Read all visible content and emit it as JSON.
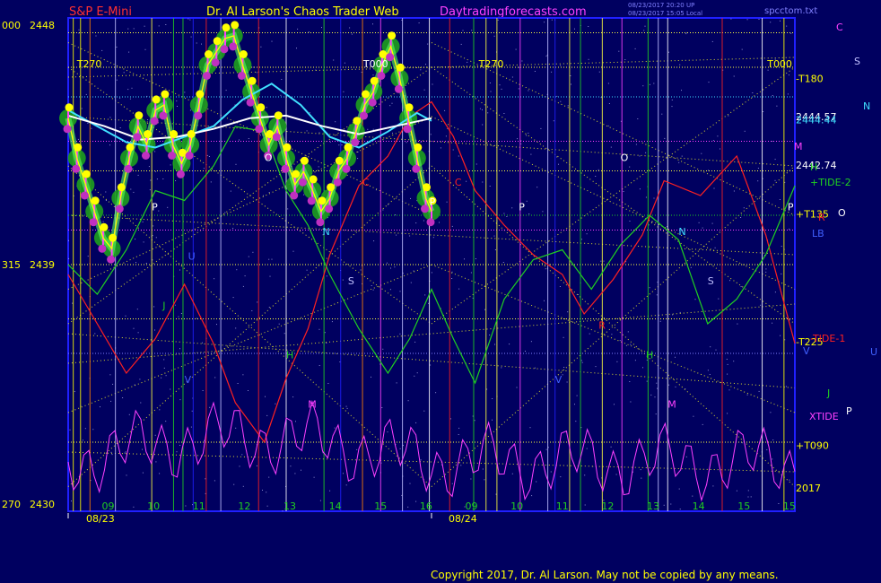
{
  "header": {
    "symbol": "S&P E-Mini",
    "site_title": "Dr. Al Larson's Chaos Trader Web",
    "site_url": "Daytradingforecasts.com",
    "stamp_line1": "08/23/2017 20:20 UP",
    "stamp_line2": "08/23/2017 15:05 Local",
    "filename": "spcctom.txt"
  },
  "copyright": "Copyright 2017, Dr. Al Larson. May not be copied by any means.",
  "colors": {
    "background": "#000060",
    "plot_border": "#2020ff",
    "price_bars": "#ff40ff",
    "cyan_avg": "#40e0ff",
    "white_avg": "#ffffff",
    "yellow_trace": "#ffff00",
    "green_glow": "#1e9e1e",
    "magenta_osc": "#ff40ff",
    "red_tide": "#ff2020",
    "green_tide": "#20d020"
  },
  "chart_data": {
    "type": "line",
    "title": "S&P E-Mini",
    "yaxis": {
      "min": 2430,
      "max": 2448
    },
    "y_ticks": [
      {
        "left": "000",
        "value_label": "2448",
        "value": 2448
      },
      {
        "left": "315",
        "value_label": "2439",
        "value": 2439
      },
      {
        "left": "270",
        "value_label": "2430",
        "value": 2430
      }
    ],
    "dates": [
      "08/23",
      "08/24"
    ],
    "day_hours": [
      "09",
      "10",
      "11",
      "12",
      "13",
      "14",
      "15",
      "16"
    ],
    "next_day_hours": [
      "09",
      "10",
      "11",
      "12",
      "13",
      "14",
      "15",
      "15"
    ],
    "right_price_labels": [
      {
        "text": "2444.57",
        "value": 2444.57
      },
      {
        "text": "2444.44",
        "value": 2444.44
      },
      {
        "text": "2442.74",
        "value": 2442.74
      }
    ],
    "right_field_labels": [
      {
        "text": "-T180",
        "value": 2446.0
      },
      {
        "text": "+T135",
        "value": 2440.9
      },
      {
        "text": "-T225",
        "value": 2436.1
      },
      {
        "text": "+T090",
        "value": 2432.2
      },
      {
        "text": "2017",
        "value": 2430.6
      }
    ],
    "right_legend": [
      {
        "text": "C",
        "color": "#ff40ff"
      },
      {
        "text": "S",
        "color": "#c0c0ff"
      },
      {
        "text": "N",
        "color": "#40e0ff"
      },
      {
        "text": "M",
        "color": "#ff40ff"
      },
      {
        "text": "H",
        "color": "#20d020"
      },
      {
        "text": "+TIDE-2",
        "color": "#20d020"
      },
      {
        "text": "R",
        "color": "#ff2020"
      },
      {
        "text": "O",
        "color": "#ffffff"
      },
      {
        "text": "LB",
        "color": "#4060ff"
      },
      {
        "text": "-TIDE-1",
        "color": "#ff2020"
      },
      {
        "text": "V",
        "color": "#4060ff"
      },
      {
        "text": "U",
        "color": "#4060ff"
      },
      {
        "text": "J",
        "color": "#20d020"
      },
      {
        "text": "XTIDE",
        "color": "#ff40ff"
      },
      {
        "text": "P",
        "color": "#ffffff"
      }
    ],
    "cycle_markers": [
      {
        "text": "T270",
        "color": "#ffff00",
        "day": 1
      },
      {
        "text": "T000",
        "color": "#ffffff",
        "day": 1
      },
      {
        "text": "T270",
        "color": "#ffff00",
        "day": 2
      },
      {
        "text": "T000",
        "color": "#ffff00",
        "day": 2
      }
    ],
    "plot_letters": [
      {
        "text": "O",
        "color": "#ffffff"
      },
      {
        "text": "P",
        "color": "#ffffff"
      },
      {
        "text": "C",
        "color": "#ff2020"
      },
      {
        "text": "C",
        "color": "#ff2020"
      },
      {
        "text": "P",
        "color": "#ffffff"
      },
      {
        "text": "P",
        "color": "#ffffff"
      },
      {
        "text": "O",
        "color": "#ffffff"
      },
      {
        "text": "N",
        "color": "#40e0ff"
      },
      {
        "text": "S",
        "color": "#c0c0ff"
      },
      {
        "text": "H",
        "color": "#20d020"
      },
      {
        "text": "M",
        "color": "#ff40ff"
      },
      {
        "text": "N",
        "color": "#40e0ff"
      },
      {
        "text": "S",
        "color": "#c0c0ff"
      },
      {
        "text": "H",
        "color": "#20d020"
      },
      {
        "text": "M",
        "color": "#ff40ff"
      },
      {
        "text": "J",
        "color": "#20d020"
      },
      {
        "text": "U",
        "color": "#4060ff"
      },
      {
        "text": "V",
        "color": "#4060ff"
      },
      {
        "text": "V",
        "color": "#4060ff"
      },
      {
        "text": "R",
        "color": "#ff2020"
      },
      {
        "text": "P",
        "color": "#ffffff"
      }
    ],
    "price_series": {
      "name": "S&P E-Mini",
      "x_frac": [
        0.0,
        0.012,
        0.024,
        0.036,
        0.048,
        0.06,
        0.072,
        0.084,
        0.096,
        0.108,
        0.12,
        0.132,
        0.144,
        0.156,
        0.168,
        0.18,
        0.192,
        0.204,
        0.216,
        0.228,
        0.24,
        0.252,
        0.264,
        0.276,
        0.288,
        0.3,
        0.312,
        0.324,
        0.336,
        0.348,
        0.36,
        0.372,
        0.384,
        0.396,
        0.408,
        0.42,
        0.432,
        0.444,
        0.456,
        0.468,
        0.48,
        0.492,
        0.5
      ],
      "values": [
        2444.5,
        2443.0,
        2442.0,
        2441.0,
        2440.0,
        2439.6,
        2441.5,
        2443.0,
        2444.2,
        2443.5,
        2444.8,
        2445.0,
        2443.5,
        2442.8,
        2443.5,
        2445.0,
        2446.5,
        2447.0,
        2447.5,
        2447.6,
        2446.5,
        2445.5,
        2444.5,
        2443.5,
        2444.2,
        2443.0,
        2442.0,
        2442.5,
        2441.8,
        2441.0,
        2441.5,
        2442.5,
        2443.0,
        2444.0,
        2445.0,
        2445.5,
        2446.5,
        2447.2,
        2446.0,
        2444.5,
        2443.0,
        2441.5,
        2441.0
      ]
    },
    "series": [
      {
        "color": "#40e0ff",
        "x_frac": [
          0.0,
          0.04,
          0.08,
          0.12,
          0.16,
          0.2,
          0.24,
          0.28,
          0.32,
          0.36,
          0.4,
          0.44,
          0.48,
          0.5
        ],
        "values": [
          2444.8,
          2444.2,
          2443.6,
          2443.4,
          2443.8,
          2444.2,
          2445.2,
          2445.8,
          2445.0,
          2443.8,
          2443.4,
          2444.0,
          2444.7,
          2444.4
        ]
      },
      {
        "color": "#ffffff",
        "x_frac": [
          0.0,
          0.05,
          0.1,
          0.15,
          0.2,
          0.25,
          0.3,
          0.35,
          0.4,
          0.45,
          0.5
        ],
        "values": [
          2444.6,
          2444.2,
          2443.7,
          2443.8,
          2444.1,
          2444.5,
          2444.6,
          2444.2,
          2443.9,
          2444.2,
          2444.5
        ]
      }
    ]
  }
}
